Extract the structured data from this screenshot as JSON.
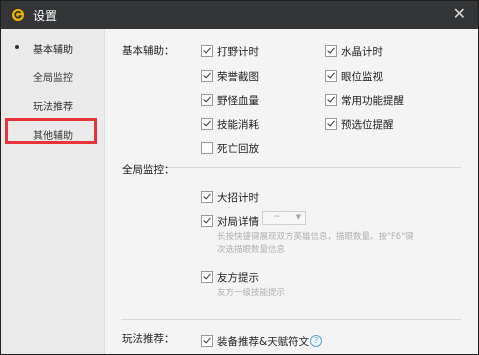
{
  "window": {
    "title": "设置",
    "logo_icon": "game-logo-icon",
    "close_icon": "close-icon",
    "close_glyph": "✕"
  },
  "sidebar": {
    "items": [
      {
        "label": "基本辅助",
        "active": true
      },
      {
        "label": "全局监控",
        "active": false
      },
      {
        "label": "玩法推荐",
        "active": false,
        "highlighted": true
      },
      {
        "label": "其他辅助",
        "active": false
      }
    ]
  },
  "content": {
    "basic": {
      "label": "基本辅助：",
      "options": [
        {
          "label": "打野计时",
          "checked": true
        },
        {
          "label": "水晶计时",
          "checked": true
        },
        {
          "label": "荣誉截图",
          "checked": true
        },
        {
          "label": "眼位监视",
          "checked": true
        },
        {
          "label": "野怪血量",
          "checked": true
        },
        {
          "label": "常用功能提醒",
          "checked": true
        },
        {
          "label": "技能消耗",
          "checked": true
        },
        {
          "label": "预选位提醒",
          "checked": true
        },
        {
          "label": "死亡回放",
          "checked": false
        }
      ]
    },
    "global": {
      "label": "全局监控：",
      "ult_timer": {
        "label": "大招计时",
        "checked": true
      },
      "match_detail": {
        "label": "对局详情",
        "checked": true
      },
      "match_detail_select": {
        "value": "~"
      },
      "match_detail_hint_1": "长按快捷键展现双方英雄信息，描眼数量。按\"F6\"键",
      "match_detail_hint_2": "次选描眼数量信息",
      "ally_hint": {
        "label": "友方提示",
        "checked": true
      },
      "ally_hint_text": "友方一级技能提示"
    },
    "play": {
      "label": "玩法推荐：",
      "option": {
        "label": "装备推荐&天赋符文",
        "checked": true
      },
      "help_glyph": "?"
    }
  },
  "colors": {
    "titlebar": "#333537",
    "highlight": "#e8333a",
    "help": "#4da3e0"
  }
}
